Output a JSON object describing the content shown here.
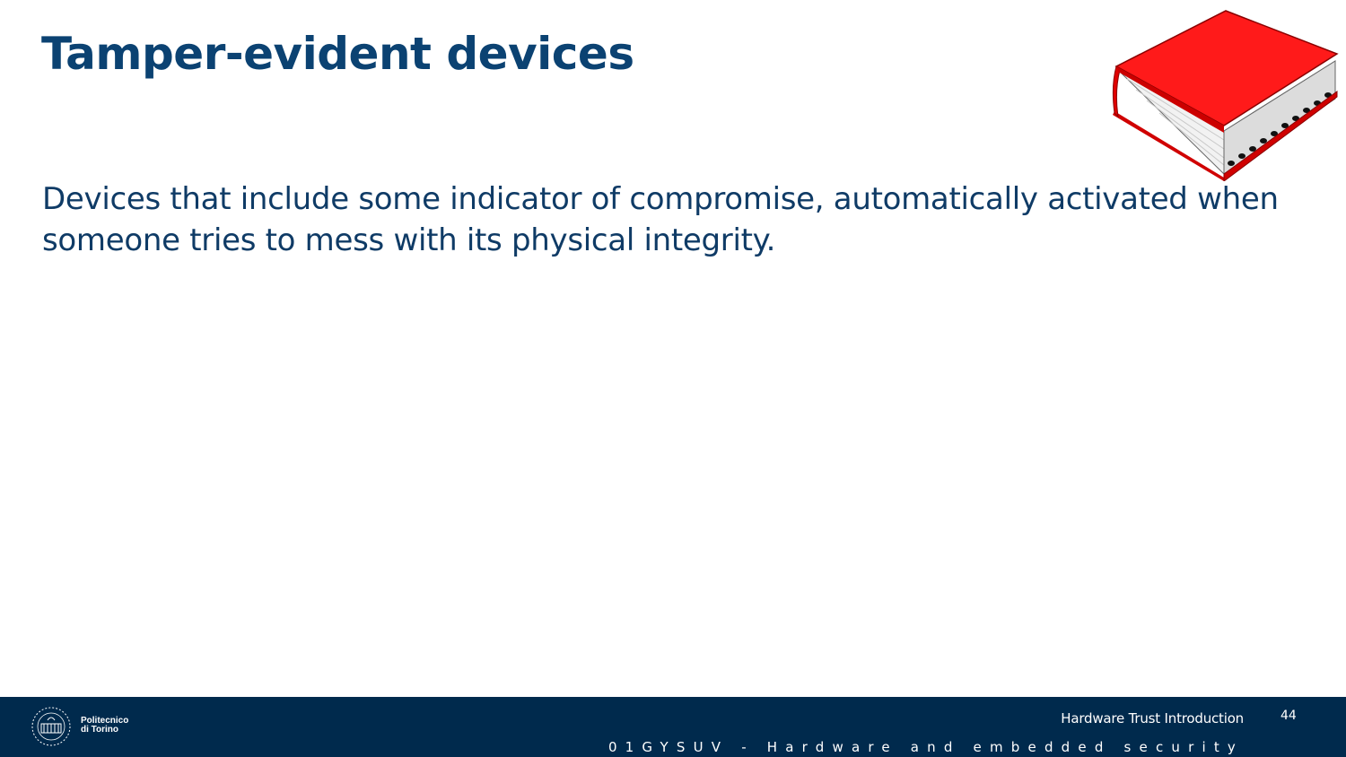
{
  "slide": {
    "title": "Tamper-evident devices",
    "body": "Devices that include some indicator of compromise, automatically activated when someone tries to mess with its physical integrity."
  },
  "illustration": {
    "icon": "red-book-icon",
    "cover_color": "#ff1a1a"
  },
  "footer": {
    "logo_line1": "Politecnico",
    "logo_line2": "di Torino",
    "presentation_title": "Hardware Trust Introduction",
    "page_number": "44",
    "course": "01GYSUV - Hardware and embedded security",
    "background_color": "#002a4d"
  }
}
